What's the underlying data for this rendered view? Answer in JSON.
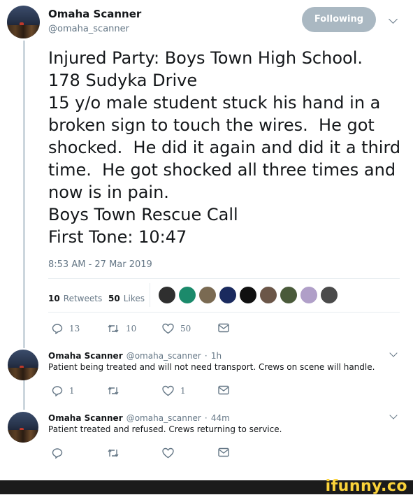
{
  "tweet": {
    "author_name": "Omaha Scanner",
    "author_handle": "@omaha_scanner",
    "follow_label": "Following",
    "body": "Injured Party: Boys Town High School.\n178 Sudyka Drive\n15 y/o male student stuck his hand in a broken sign to touch the wires.  He got shocked.  He did it again and did it a third time.  He got shocked all three times and now is in pain.\nBoys Town Rescue Call\nFirst Tone: 10:47",
    "timestamp": "8:53 AM - 27 Mar 2019",
    "retweets_count": "10",
    "retweets_label": "Retweets",
    "likes_count": "50",
    "likes_label": "Likes",
    "likers": [
      "#2f2f2f",
      "#1b8a6b",
      "#7a6a52",
      "#1a2a5e",
      "#101010",
      "#6b5648",
      "#4a5a3a",
      "#b09fc8",
      "#4a4a4a"
    ],
    "actions": {
      "replies": "13",
      "retweets": "10",
      "likes": "50"
    }
  },
  "replies": [
    {
      "author_name": "Omaha Scanner",
      "author_handle": "@omaha_scanner",
      "age": "1h",
      "text": "Patient being treated and will not need transport.  Crews on scene will handle.",
      "actions": {
        "replies": "1",
        "retweets": "",
        "likes": "1"
      }
    },
    {
      "author_name": "Omaha Scanner",
      "author_handle": "@omaha_scanner",
      "age": "44m",
      "text": "Patient treated and refused.  Crews returning to service.",
      "actions": {
        "replies": "",
        "retweets": "",
        "likes": ""
      }
    }
  ],
  "footer": {
    "watermark": "ifunny.co"
  },
  "colors": {
    "follow_bg": "#aab8c2",
    "muted": "#657786",
    "text": "#14171a",
    "footer_bg": "#1b1b1b",
    "watermark": "#fbd33a"
  }
}
